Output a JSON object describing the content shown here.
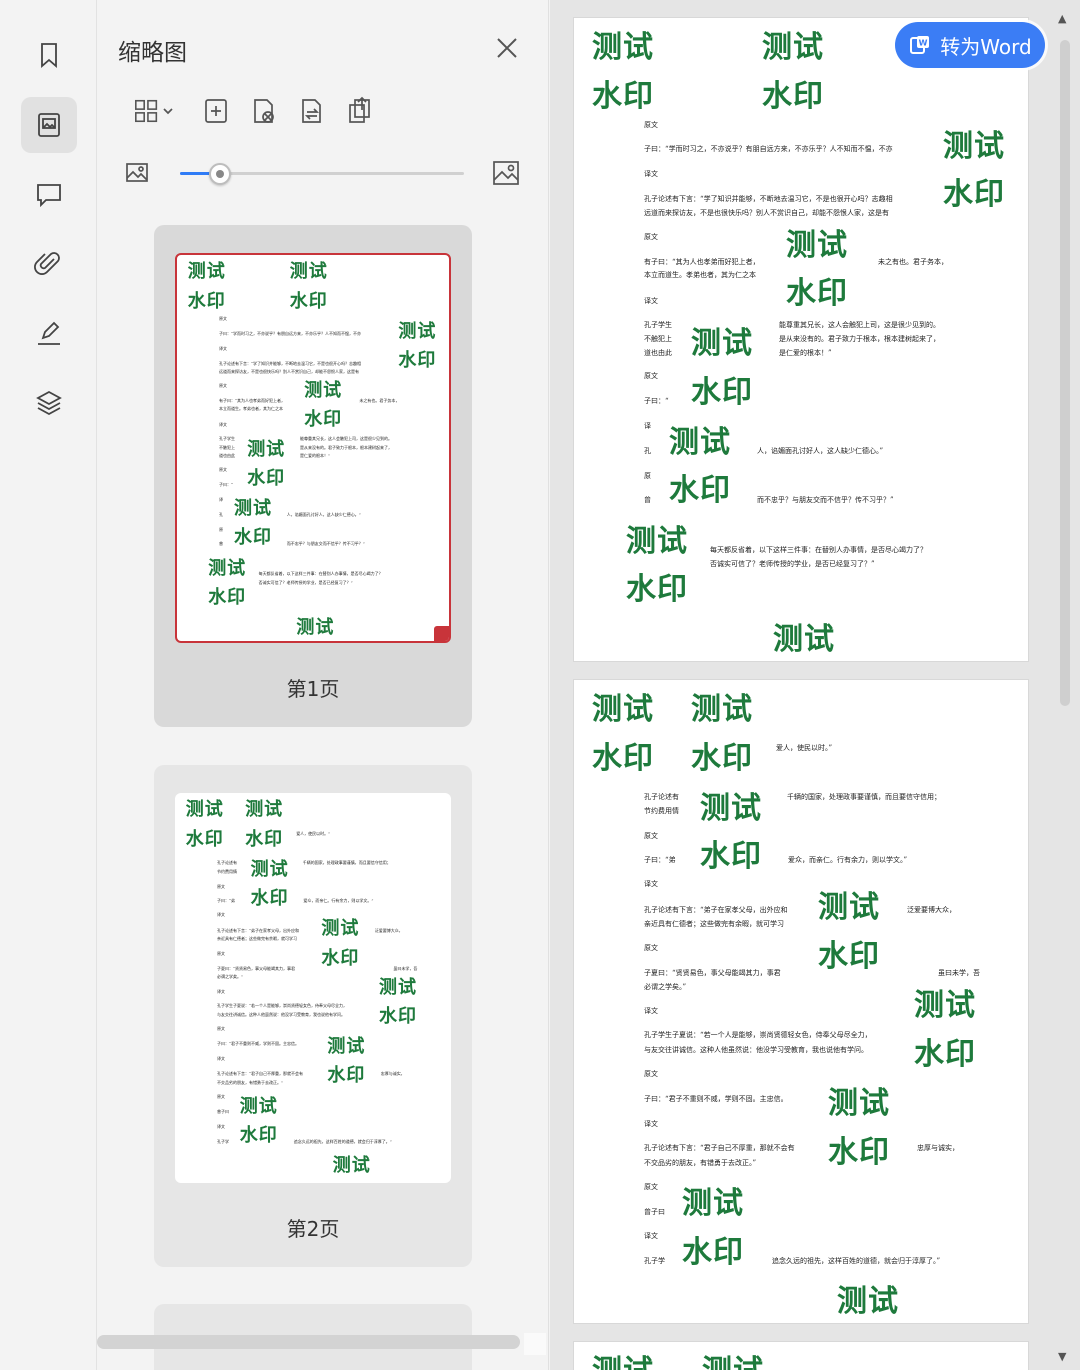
{
  "rail": {
    "items": [
      {
        "name": "bookmark-icon"
      },
      {
        "name": "thumbnail-icon",
        "active": true
      },
      {
        "name": "comment-icon"
      },
      {
        "name": "attachment-icon"
      },
      {
        "name": "signature-icon"
      },
      {
        "name": "layers-icon"
      }
    ]
  },
  "panel": {
    "title": "缩略图",
    "close_icon": "close-icon",
    "toolbar": [
      "grid-view-icon",
      "insert-page-icon",
      "delete-page-icon",
      "replace-page-icon",
      "extract-page-icon"
    ],
    "zoom_level": 0.14,
    "pages": [
      {
        "label": "第1页",
        "selected": true
      },
      {
        "label": "第2页",
        "selected": false
      }
    ]
  },
  "main": {
    "convert_button": "转为Word",
    "watermark_top": "测试",
    "watermark_bottom": "水印",
    "page1_lines": [
      "原文",
      "子曰：“学而时习之，不亦说乎？有朋自远方来，不亦乐乎？人不知而不愠，不亦",
      "译文",
      "孔子论述有下言：“学了知识并能够，不断地去温习它，不是也很开心吗？志趣相",
      "远道而来探访友，不是也很快乐吗？别人不赏识自己，却能不怨恨人家，这是有",
      "原文",
      "有子曰：“其为人也孝弟而好犯上者，",
      "未之有也。君子务本，",
      "本立而道生。孝弟也者，其为仁之本",
      "译文",
      "孔子学生",
      "能尊重其兄长，这人会触犯上司，这是很少见到的。",
      "不触犯上",
      "是从来没有的。君子致力于根本，根本建树起来了，",
      "道也由此",
      "是仁爱的根本！”",
      "原文",
      "子曰：“",
      "译",
      "孔",
      "人，谄媚面孔讨好人，这人缺少仁德心。”",
      "原",
      "曾",
      "而不忠乎？与朋友交而不信乎？传不习乎？”",
      "每天都反省着，以下这样三件事：在替别人办事情，是否尽心竭力了？",
      "否诚实可信了？老师传授的学业，是否已经复习了？”"
    ],
    "page2_lines": [
      "爱人，使民以时。”",
      "孔子论述有",
      "千辆的国家，处理政事要谨慎，而且要信守信用；",
      "节约费用情",
      "原文",
      "子曰：“弟",
      "爱众，而亲仁。行有余力，则以学文。”",
      "译文",
      "孔子论述有下言：“弟子在家孝父母，出外应和",
      "泛爱要博大众，",
      "亲近具有仁德者；这些做完有余暇，就可学习",
      "原文",
      "子夏曰：“贤贤易色，事父母能竭其力，事君",
      "虽曰未学，吾",
      "必谓之学矣。”",
      "译文",
      "孔子学生子夏说：“若一个人是能够，崇尚贤德轻女色，侍奉父母尽全力，",
      "与友交往讲诚信。这种人他虽然说：他没学习受教育，我也说他有学问。",
      "原文",
      "子曰：“君子不重则不威，学则不固。主忠信。",
      "译文",
      "孔子论述有下言：“君子自己不厚重，那就不会有",
      "忠厚与诚实，",
      "不交品劣的朋友，有错勇于去改正。”",
      "原文",
      "曾子曰",
      "译文",
      "孔子学",
      "追念久远的祖先，这样百姓的道德，就会归于淳厚了。”"
    ]
  },
  "colors": {
    "watermark": "#1e7a3c",
    "accent": "#3b7df5",
    "selected_border": "#c8343a"
  }
}
